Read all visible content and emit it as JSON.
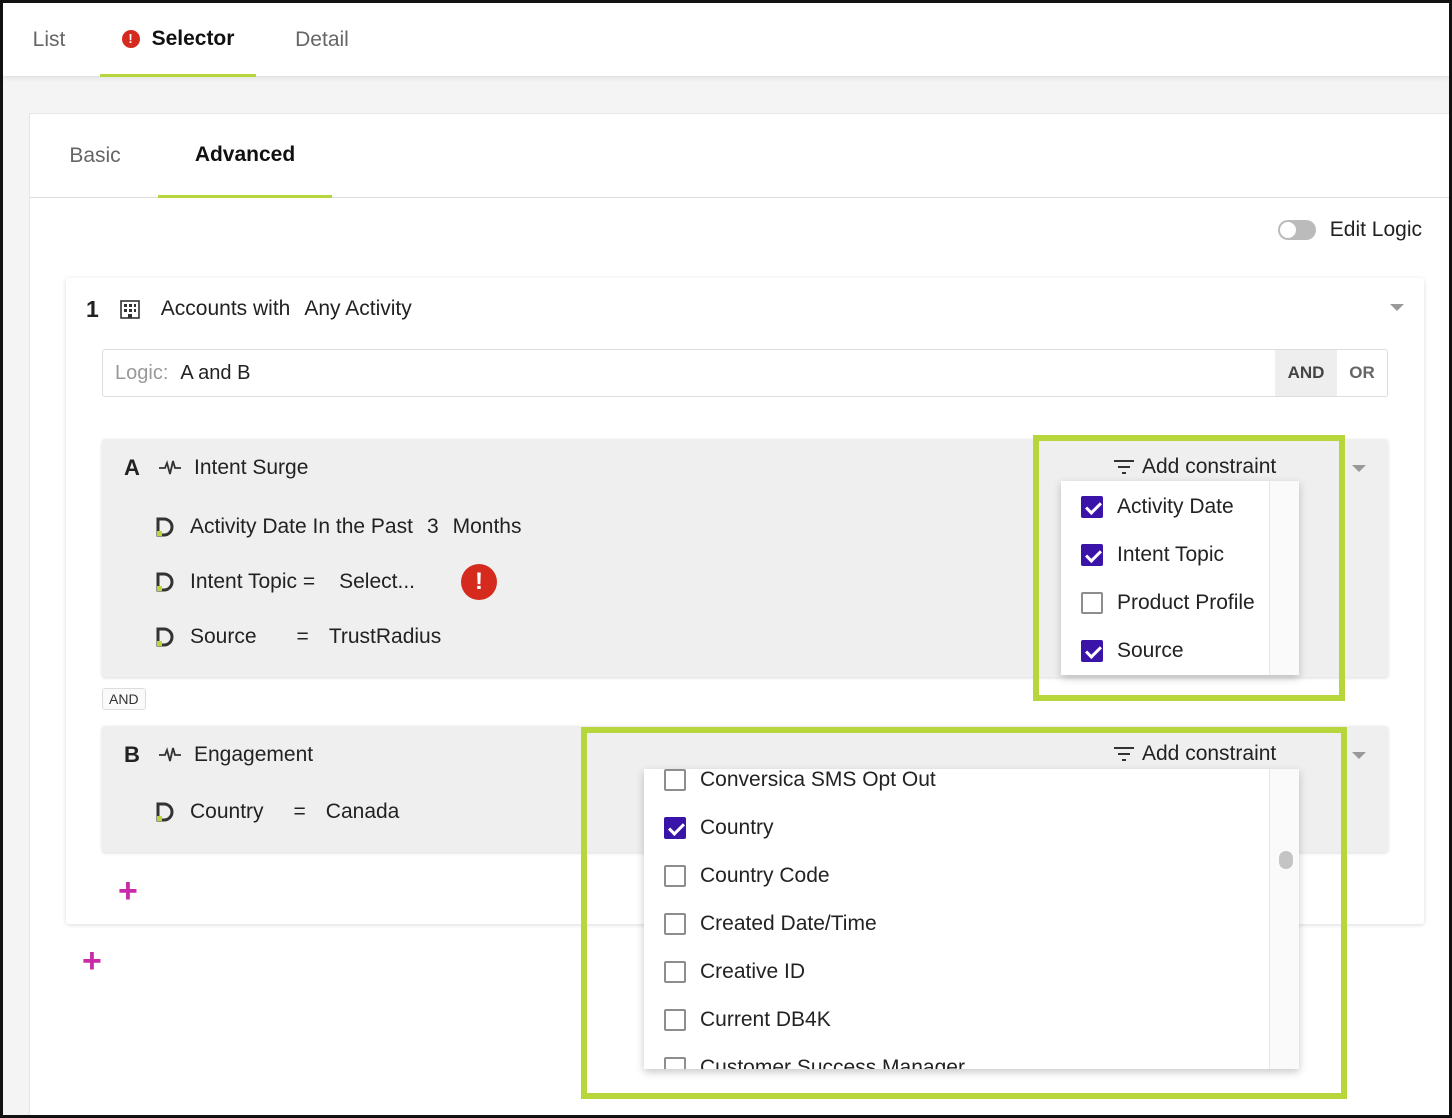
{
  "top_tabs": {
    "list": "List",
    "selector": "Selector",
    "detail": "Detail",
    "selector_alert": "!"
  },
  "sub_tabs": {
    "basic": "Basic",
    "advanced": "Advanced"
  },
  "edit_logic": {
    "label": "Edit Logic",
    "enabled": false
  },
  "card": {
    "number": "1",
    "entity_icon": "building-icon",
    "accounts_label": "Accounts with",
    "activity_label": "Any Activity",
    "logic": {
      "prefix": "Logic:",
      "value": "A and B",
      "and_label": "AND",
      "or_label": "OR",
      "selected": "AND"
    }
  },
  "groups": {
    "a": {
      "letter": "A",
      "title": "Intent Surge",
      "add_constraint": "Add constraint",
      "rows": [
        {
          "field": "Activity Date In the Past",
          "op": "3",
          "value": "Months"
        },
        {
          "field": "Intent Topic =",
          "op": "",
          "value": "Select...",
          "alert": "!"
        },
        {
          "field": "Source",
          "op": "=",
          "value": "TrustRadius"
        }
      ],
      "dropdown": [
        {
          "label": "Activity Date",
          "checked": true
        },
        {
          "label": "Intent Topic",
          "checked": true
        },
        {
          "label": "Product Profile",
          "checked": false
        },
        {
          "label": "Source",
          "checked": true
        }
      ]
    },
    "joiner": "AND",
    "b": {
      "letter": "B",
      "title": "Engagement",
      "add_constraint": "Add constraint",
      "rows": [
        {
          "field": "Country",
          "op": "=",
          "value": "Canada"
        }
      ],
      "dropdown": [
        {
          "label": "Conversica SMS Opt Out",
          "checked": false
        },
        {
          "label": "Country",
          "checked": true
        },
        {
          "label": "Country Code",
          "checked": false
        },
        {
          "label": "Created Date/Time",
          "checked": false
        },
        {
          "label": "Creative ID",
          "checked": false
        },
        {
          "label": "Current DB4K",
          "checked": false
        },
        {
          "label": "Customer Success Manager",
          "checked": false
        }
      ]
    }
  },
  "colors": {
    "accent_green": "#b7d63b",
    "checkbox_purple": "#3a13a8",
    "alert_red": "#d42b1e",
    "plus_magenta": "#c92aa8"
  }
}
